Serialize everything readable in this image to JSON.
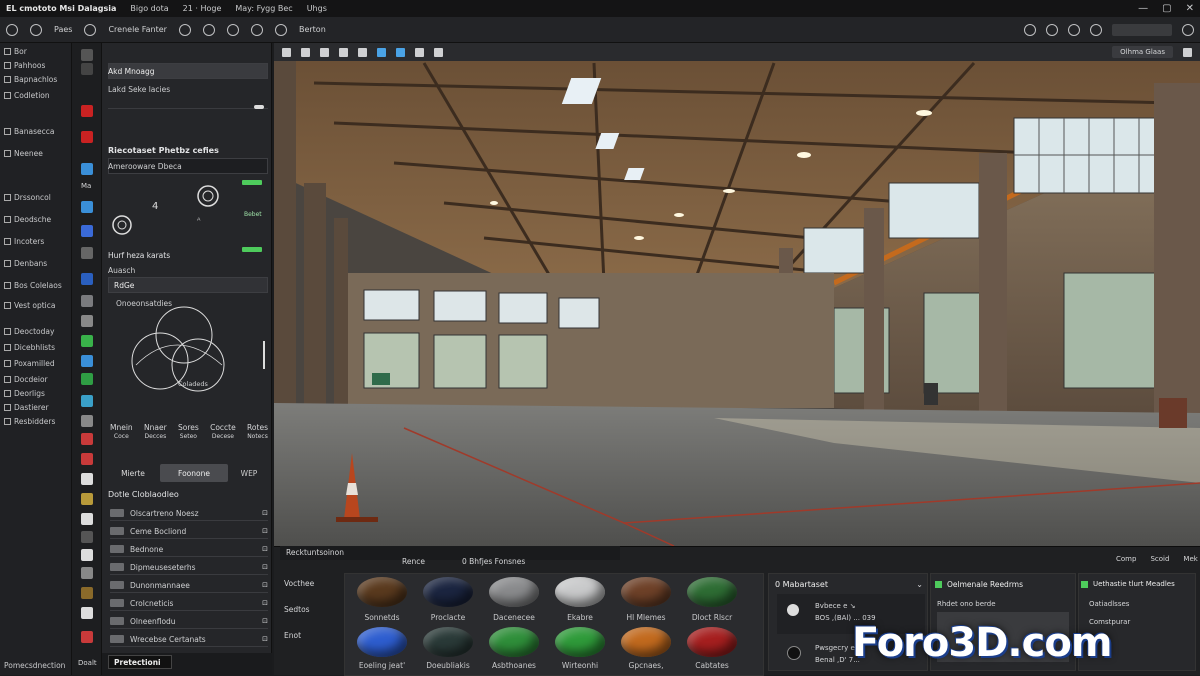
{
  "titlebar": {
    "app": "EL cmototo Msi Dalagsia",
    "menus": [
      "Bigo dota",
      "21 · Hoge",
      "May: Fygg Bec",
      "Uhgs"
    ]
  },
  "toolbar": {
    "items": [
      "Paes",
      "Crenele Fanter",
      "Berton"
    ],
    "right_label": ""
  },
  "leftnav": {
    "items": [
      "Bor",
      "Pahhoos",
      "Bapnachlos",
      "Codletion",
      "Banasecca",
      "Neenee",
      "Drssoncol",
      "Deodsche",
      "Incoters",
      "Denbans",
      "Bos Colelaos",
      "Vest optica",
      "Deoctoday",
      "Dicebhlists",
      "Poxamilled",
      "Docdeior",
      "Deorligs",
      "Dastierer",
      "Resbidders"
    ],
    "footer": "Pomecsdnection"
  },
  "iconstrip": {
    "label": "Ma",
    "footer": "Doalt"
  },
  "props": {
    "top_title": "Akd Mnoagg",
    "top_sub": "Lakd Seke lacies",
    "section1": "Riecotaset Phetbz cefies",
    "field1": "Amerooware Dbeca",
    "value_badge": "Bebet",
    "section2": "Hurf heza karats",
    "sub2": "Auasch",
    "field2": "RdGe",
    "graph_label": "Onoeonsatdies",
    "graph_center": "Coladeds",
    "modes": [
      {
        "top": "Mnein",
        "bot": "Coce"
      },
      {
        "top": "Nnaer",
        "bot": "Decces"
      },
      {
        "top": "Sores",
        "bot": "Seteo"
      },
      {
        "top": "Coccte",
        "bot": "Decese"
      },
      {
        "top": "Rotes",
        "bot": "Notecs"
      }
    ],
    "tabs": [
      "Mierte",
      "Foonone",
      "WEP"
    ],
    "mat_header": "Dotle Cloblaodleo",
    "materials": [
      "Olscartreno Noesz",
      "Ceme Bocliond",
      "Bednone",
      "Dipmeuseseterhs",
      "Dunonmannaee",
      "Crolcneticis",
      "Olneenflodu",
      "Wrecebse Certanats"
    ],
    "footer": "Pretectioni"
  },
  "viewport": {
    "toolbar_right": "Olhma Glaas"
  },
  "bottom": {
    "header": "Recktuntsoinon",
    "tabs": [
      "Rence",
      "0 Bhfjes Fonsnes"
    ],
    "right_menu": [
      "Comp",
      "Scoid",
      "Mek"
    ],
    "side_buttons": [
      "Vocthee",
      "Sedtos",
      "Enot"
    ],
    "materials_row1": [
      {
        "name": "Sonnetds",
        "color": "#5a3a1e"
      },
      {
        "name": "Proclacte",
        "color": "#1b2540"
      },
      {
        "name": "Dacenecee",
        "color": "#8a8b8d"
      },
      {
        "name": "Ekabre",
        "color": "#c9cacb"
      },
      {
        "name": "Hl Mlemes",
        "color": "#6e4128"
      },
      {
        "name": "Dloct Rlscr",
        "color": "#2e6d34"
      }
    ],
    "materials_row2": [
      {
        "name": "Eoeling jeat'",
        "color": "#2e5ed0"
      },
      {
        "name": "Doeubliakis",
        "color": "#2a3a38"
      },
      {
        "name": "Asbthoanes",
        "color": "#2f8f3a"
      },
      {
        "name": "Wirteonhi",
        "color": "#2f9b3a"
      },
      {
        "name": "Gpcnaes,",
        "color": "#c26a1e"
      },
      {
        "name": "Cabtates",
        "color": "#a61f1f"
      }
    ],
    "panel1": {
      "title": "0 Mabartaset",
      "line1": "Bvbece e ↘",
      "line2": "BOS ,(BAl) ... 039",
      "line3": "Pwsgecry e",
      "line4": "Benal ,D' 7..."
    },
    "panel2": {
      "title": "Oelmenale Reedrms",
      "sub": "Rhdet ono berde"
    },
    "panel3": {
      "title": "Uethastie tlurt Meadles",
      "rows": [
        "Oatiadlsses",
        "Comstpurar"
      ]
    }
  },
  "watermark": "Foro3D.com"
}
